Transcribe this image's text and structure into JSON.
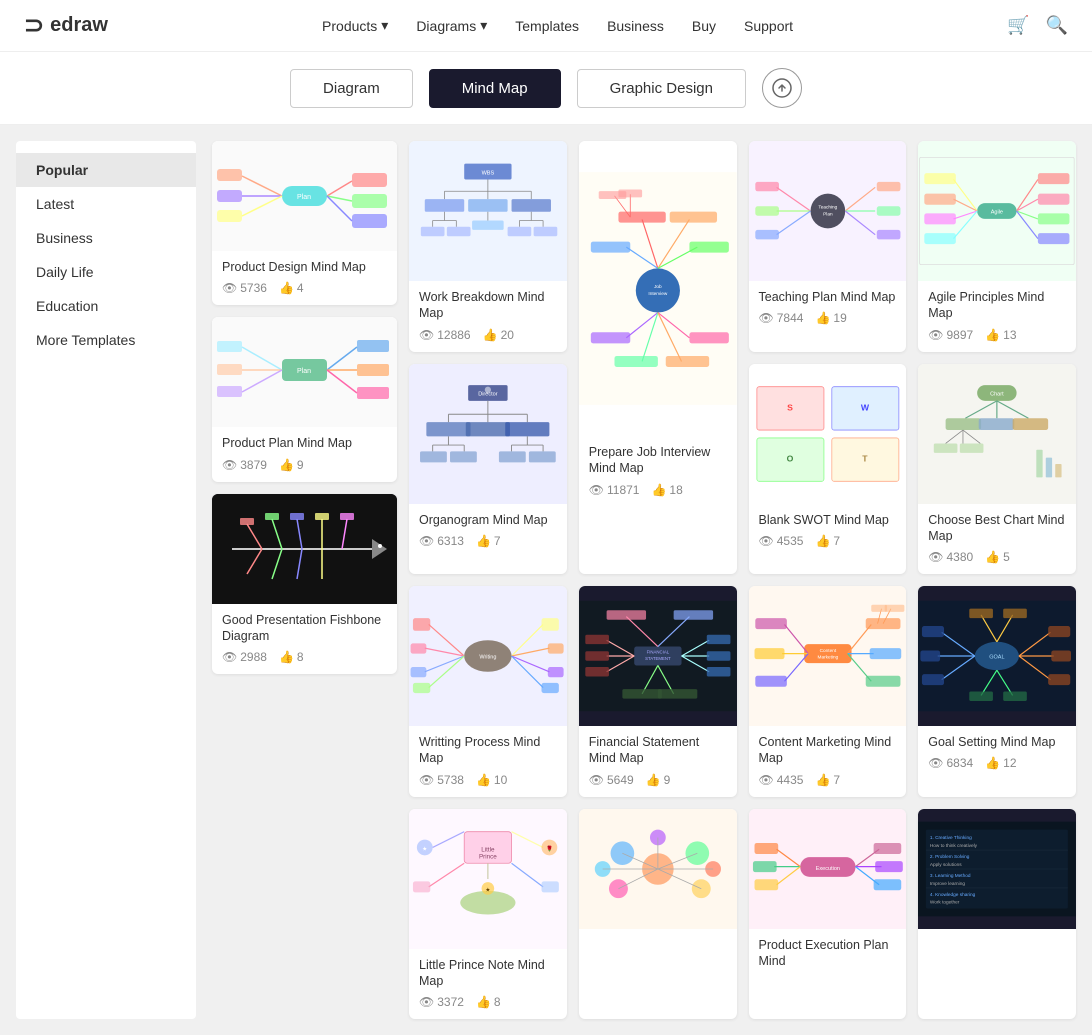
{
  "header": {
    "logo": "edraw",
    "nav": [
      {
        "label": "Products",
        "hasArrow": true
      },
      {
        "label": "Diagrams",
        "hasArrow": true
      },
      {
        "label": "Templates"
      },
      {
        "label": "Business"
      },
      {
        "label": "Buy"
      },
      {
        "label": "Support"
      }
    ]
  },
  "tabs": [
    {
      "label": "Diagram",
      "active": false
    },
    {
      "label": "Mind Map",
      "active": true
    },
    {
      "label": "Graphic Design",
      "active": false
    }
  ],
  "sidebar": {
    "items": [
      {
        "label": "Popular",
        "active": true
      },
      {
        "label": "Latest"
      },
      {
        "label": "Business"
      },
      {
        "label": "Daily Life"
      },
      {
        "label": "Education"
      },
      {
        "label": "More Templates"
      }
    ]
  },
  "cards": [
    {
      "id": "work-breakdown",
      "title": "Work Breakdown Mind Map",
      "views": "12886",
      "likes": "20",
      "theme": "light-blue",
      "col": 2
    },
    {
      "id": "prepare-job",
      "title": "Prepare Job Interview Mind Map",
      "views": "11871",
      "likes": "18",
      "theme": "colorful",
      "col": 3,
      "tall": true
    },
    {
      "id": "teaching-plan",
      "title": "Teaching Plan Mind Map",
      "views": "7844",
      "likes": "19",
      "theme": "purple-blue",
      "col": 4
    },
    {
      "id": "agile-principles",
      "title": "Agile Principles Mind Map",
      "views": "9897",
      "likes": "13",
      "theme": "green-multi",
      "col": 5
    },
    {
      "id": "product-design",
      "title": "Product Design Mind Map",
      "views": "5736",
      "likes": "4",
      "theme": "pastel",
      "col": 1,
      "sidebar": true
    },
    {
      "id": "organogram",
      "title": "Organogram Mind Map",
      "views": "6313",
      "likes": "7",
      "theme": "blue-dark",
      "col": 2
    },
    {
      "id": "blank-swot",
      "title": "Blank SWOT Mind Map",
      "views": "4535",
      "likes": "7",
      "theme": "simple",
      "col": 3
    },
    {
      "id": "choose-best-chart",
      "title": "Choose Best Chart Mind Map",
      "views": "4380",
      "likes": "5",
      "theme": "light-green",
      "col": 4
    },
    {
      "id": "writing-process",
      "title": "Writting Process Mind Map",
      "views": "5738",
      "likes": "10",
      "theme": "multi-dark",
      "col": 5
    },
    {
      "id": "product-plan",
      "title": "Product Plan Mind Map",
      "views": "3879",
      "likes": "9",
      "theme": "dark-fish",
      "col": 1,
      "sidebar": true
    },
    {
      "id": "financial-statement",
      "title": "Financial Statement Mind Map",
      "views": "5649",
      "likes": "9",
      "theme": "dark",
      "col": 2
    },
    {
      "id": "content-marketing",
      "title": "Content Marketing Mind Map",
      "views": "4435",
      "likes": "7",
      "theme": "colorful2",
      "col": 3
    },
    {
      "id": "goal-setting",
      "title": "Goal Setting Mind Map",
      "views": "6834",
      "likes": "12",
      "theme": "dark2",
      "col": 4
    },
    {
      "id": "little-prince",
      "title": "Little Prince Note Mind Map",
      "views": "3372",
      "likes": "8",
      "theme": "illustrated",
      "col": 5
    },
    {
      "id": "good-presentation",
      "title": "Good Presentation Fishbone Diagram",
      "views": "2988",
      "likes": "8",
      "theme": "dark-fish2",
      "col": 1,
      "sidebar": true
    },
    {
      "id": "product-exec",
      "title": "Product Execution Plan Mind",
      "views": "",
      "likes": "",
      "theme": "light-pink",
      "col": 3,
      "partial": true
    },
    {
      "id": "colorful-bubble",
      "title": "",
      "views": "",
      "likes": "",
      "theme": "bubbles",
      "col": 2,
      "partial": true
    },
    {
      "id": "dark-map2",
      "title": "",
      "views": "",
      "likes": "",
      "theme": "dark3",
      "col": 4,
      "partial": true
    }
  ]
}
